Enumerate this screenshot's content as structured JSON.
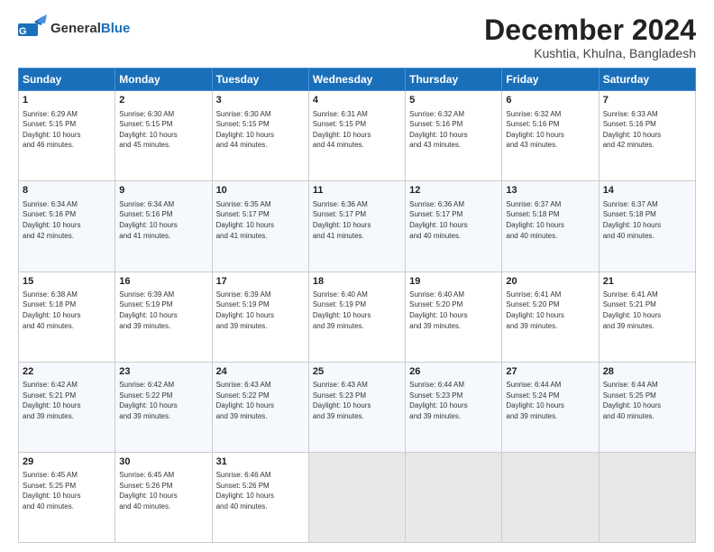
{
  "header": {
    "logo_general": "General",
    "logo_blue": "Blue",
    "title": "December 2024",
    "subtitle": "Kushtia, Khulna, Bangladesh"
  },
  "calendar": {
    "days_of_week": [
      "Sunday",
      "Monday",
      "Tuesday",
      "Wednesday",
      "Thursday",
      "Friday",
      "Saturday"
    ],
    "weeks": [
      [
        {
          "day": "",
          "info": ""
        },
        {
          "day": "2",
          "info": "Sunrise: 6:30 AM\nSunset: 5:15 PM\nDaylight: 10 hours\nand 45 minutes."
        },
        {
          "day": "3",
          "info": "Sunrise: 6:30 AM\nSunset: 5:15 PM\nDaylight: 10 hours\nand 44 minutes."
        },
        {
          "day": "4",
          "info": "Sunrise: 6:31 AM\nSunset: 5:15 PM\nDaylight: 10 hours\nand 44 minutes."
        },
        {
          "day": "5",
          "info": "Sunrise: 6:32 AM\nSunset: 5:16 PM\nDaylight: 10 hours\nand 43 minutes."
        },
        {
          "day": "6",
          "info": "Sunrise: 6:32 AM\nSunset: 5:16 PM\nDaylight: 10 hours\nand 43 minutes."
        },
        {
          "day": "7",
          "info": "Sunrise: 6:33 AM\nSunset: 5:16 PM\nDaylight: 10 hours\nand 42 minutes."
        }
      ],
      [
        {
          "day": "1",
          "info": "Sunrise: 6:29 AM\nSunset: 5:15 PM\nDaylight: 10 hours\nand 46 minutes.",
          "first_col": true
        },
        {
          "day": "9",
          "info": "Sunrise: 6:34 AM\nSunset: 5:16 PM\nDaylight: 10 hours\nand 41 minutes."
        },
        {
          "day": "10",
          "info": "Sunrise: 6:35 AM\nSunset: 5:17 PM\nDaylight: 10 hours\nand 41 minutes."
        },
        {
          "day": "11",
          "info": "Sunrise: 6:36 AM\nSunset: 5:17 PM\nDaylight: 10 hours\nand 41 minutes."
        },
        {
          "day": "12",
          "info": "Sunrise: 6:36 AM\nSunset: 5:17 PM\nDaylight: 10 hours\nand 40 minutes."
        },
        {
          "day": "13",
          "info": "Sunrise: 6:37 AM\nSunset: 5:18 PM\nDaylight: 10 hours\nand 40 minutes."
        },
        {
          "day": "14",
          "info": "Sunrise: 6:37 AM\nSunset: 5:18 PM\nDaylight: 10 hours\nand 40 minutes."
        }
      ],
      [
        {
          "day": "8",
          "info": "Sunrise: 6:34 AM\nSunset: 5:16 PM\nDaylight: 10 hours\nand 42 minutes.",
          "first_col": true
        },
        {
          "day": "16",
          "info": "Sunrise: 6:39 AM\nSunset: 5:19 PM\nDaylight: 10 hours\nand 39 minutes."
        },
        {
          "day": "17",
          "info": "Sunrise: 6:39 AM\nSunset: 5:19 PM\nDaylight: 10 hours\nand 39 minutes."
        },
        {
          "day": "18",
          "info": "Sunrise: 6:40 AM\nSunset: 5:19 PM\nDaylight: 10 hours\nand 39 minutes."
        },
        {
          "day": "19",
          "info": "Sunrise: 6:40 AM\nSunset: 5:20 PM\nDaylight: 10 hours\nand 39 minutes."
        },
        {
          "day": "20",
          "info": "Sunrise: 6:41 AM\nSunset: 5:20 PM\nDaylight: 10 hours\nand 39 minutes."
        },
        {
          "day": "21",
          "info": "Sunrise: 6:41 AM\nSunset: 5:21 PM\nDaylight: 10 hours\nand 39 minutes."
        }
      ],
      [
        {
          "day": "15",
          "info": "Sunrise: 6:38 AM\nSunset: 5:18 PM\nDaylight: 10 hours\nand 40 minutes.",
          "first_col": true
        },
        {
          "day": "23",
          "info": "Sunrise: 6:42 AM\nSunset: 5:22 PM\nDaylight: 10 hours\nand 39 minutes."
        },
        {
          "day": "24",
          "info": "Sunrise: 6:43 AM\nSunset: 5:22 PM\nDaylight: 10 hours\nand 39 minutes."
        },
        {
          "day": "25",
          "info": "Sunrise: 6:43 AM\nSunset: 5:23 PM\nDaylight: 10 hours\nand 39 minutes."
        },
        {
          "day": "26",
          "info": "Sunrise: 6:44 AM\nSunset: 5:23 PM\nDaylight: 10 hours\nand 39 minutes."
        },
        {
          "day": "27",
          "info": "Sunrise: 6:44 AM\nSunset: 5:24 PM\nDaylight: 10 hours\nand 39 minutes."
        },
        {
          "day": "28",
          "info": "Sunrise: 6:44 AM\nSunset: 5:25 PM\nDaylight: 10 hours\nand 40 minutes."
        }
      ],
      [
        {
          "day": "22",
          "info": "Sunrise: 6:42 AM\nSunset: 5:21 PM\nDaylight: 10 hours\nand 39 minutes.",
          "first_col": true
        },
        {
          "day": "30",
          "info": "Sunrise: 6:45 AM\nSunset: 5:26 PM\nDaylight: 10 hours\nand 40 minutes."
        },
        {
          "day": "31",
          "info": "Sunrise: 6:46 AM\nSunset: 5:26 PM\nDaylight: 10 hours\nand 40 minutes."
        },
        {
          "day": "",
          "info": ""
        },
        {
          "day": "",
          "info": ""
        },
        {
          "day": "",
          "info": ""
        },
        {
          "day": "",
          "info": ""
        }
      ],
      [
        {
          "day": "29",
          "info": "Sunrise: 6:45 AM\nSunset: 5:25 PM\nDaylight: 10 hours\nand 40 minutes.",
          "first_col": true
        }
      ]
    ]
  }
}
